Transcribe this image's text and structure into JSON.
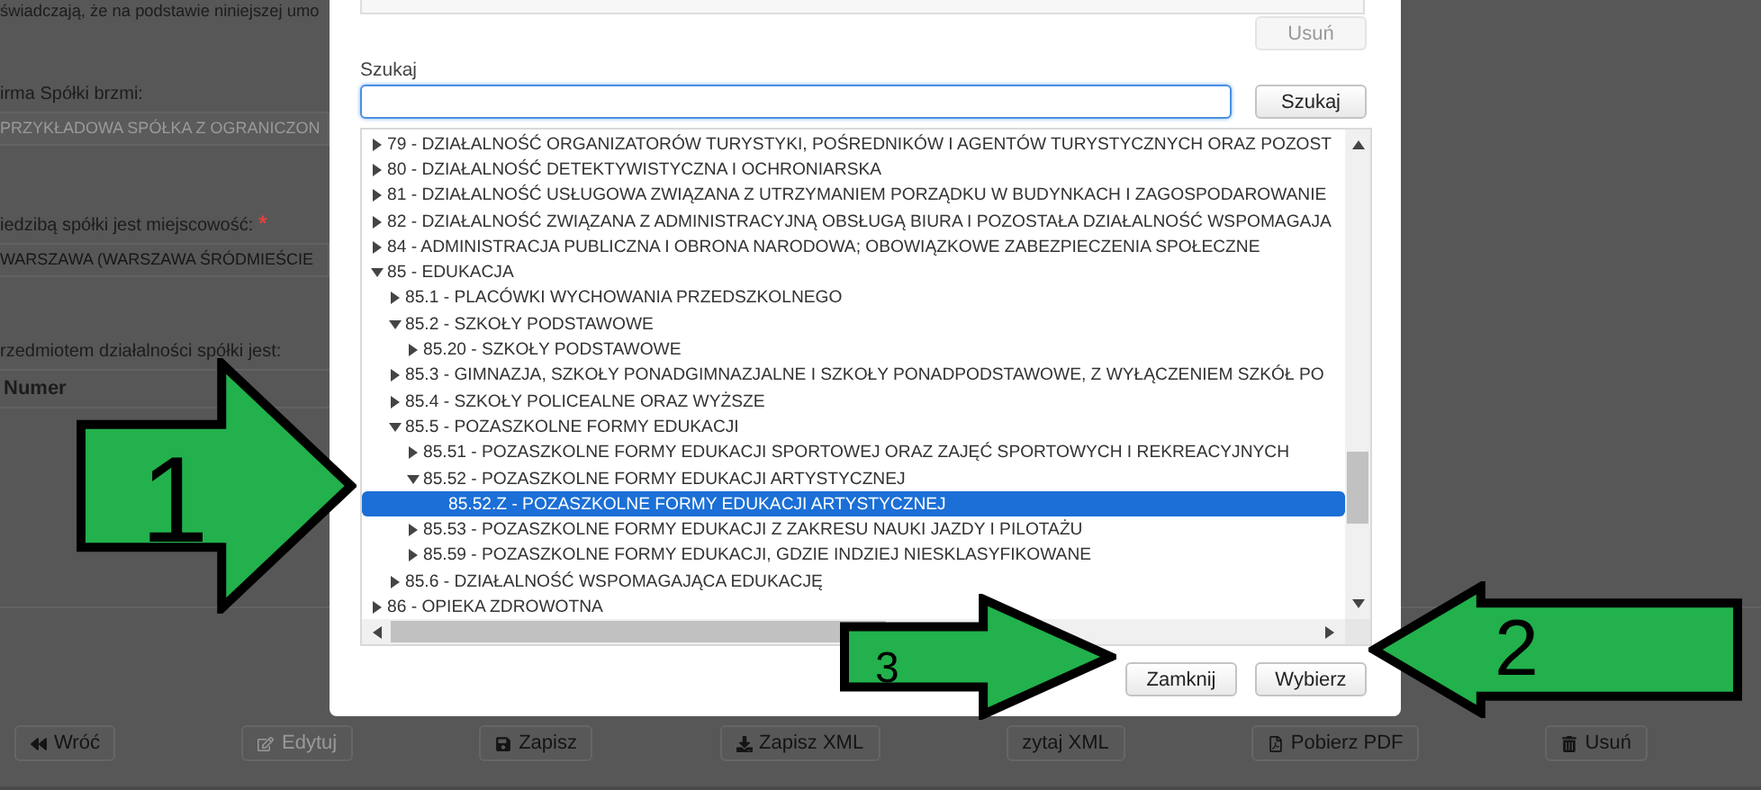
{
  "page": {
    "intro": "świadczają, że na podstawie niniejszej umo",
    "company_name_label": "irma Spółki brzmi:",
    "company_name_value": "PRZYKŁADOWA SPÓŁKA Z OGRANICZON",
    "seat_label": "iedzibą spółki jest miejscowość:",
    "seat_required_mark": "*",
    "seat_value": "WARSZAWA (WARSZAWA ŚRÓDMIEŚCIE",
    "activity_label": "rzedmiotem działalności spółki jest:",
    "table": {
      "columns": [
        "Numer"
      ]
    }
  },
  "toolbar": [
    {
      "label": "Wróć",
      "kind": "back",
      "disabled": false
    },
    {
      "label": "Edytuj",
      "kind": "edit",
      "disabled": true
    },
    {
      "label": "Zapisz",
      "kind": "save",
      "disabled": false
    },
    {
      "label": "Zapisz XML",
      "kind": "download",
      "disabled": false
    },
    {
      "label": "zytaj XML",
      "kind": "none",
      "disabled": false
    },
    {
      "label": "Pobierz PDF",
      "kind": "file",
      "disabled": false
    },
    {
      "label": "Usuń",
      "kind": "trash",
      "disabled": false
    }
  ],
  "dialog": {
    "delete_button": {
      "label": "Usuń",
      "disabled": true
    },
    "search": {
      "label": "Szukaj",
      "button": "Szukaj"
    },
    "tree": [
      {
        "label": "79 - DZIAŁALNOŚĆ ORGANIZATORÓW TURYSTYKI, POŚREDNIKÓW I AGENTÓW TURYSTYCZNYCH ORAZ POZOST",
        "expanded": false,
        "selected": false
      },
      {
        "label": "80 - DZIAŁALNOŚĆ DETEKTYWISTYCZNA I OCHRONIARSKA",
        "expanded": false,
        "selected": false
      },
      {
        "label": "81 - DZIAŁALNOŚĆ USŁUGOWA ZWIĄZANA Z UTRZYMANIEM PORZĄDKU W BUDYNKACH I ZAGOSPODAROWANIE",
        "expanded": false,
        "selected": false
      },
      {
        "label": "82 - DZIAŁALNOŚĆ ZWIĄZANA Z ADMINISTRACYJNĄ OBSŁUGĄ BIURA I POZOSTAŁA DZIAŁALNOŚĆ WSPOMAGAJA",
        "expanded": false,
        "selected": false
      },
      {
        "label": "84 - ADMINISTRACJA PUBLICZNA I OBRONA NARODOWA; OBOWIĄZKOWE ZABEZPIECZENIA SPOŁECZNE",
        "expanded": false,
        "selected": false
      },
      {
        "label": "85 - EDUKACJA",
        "expanded": true,
        "selected": false,
        "children": [
          {
            "label": "85.1 - PLACÓWKI WYCHOWANIA PRZEDSZKOLNEGO",
            "expanded": false,
            "selected": false
          },
          {
            "label": "85.2 - SZKOŁY PODSTAWOWE",
            "expanded": true,
            "selected": false,
            "children": [
              {
                "label": "85.20 - SZKOŁY PODSTAWOWE",
                "expanded": false,
                "selected": false
              }
            ]
          },
          {
            "label": "85.3 - GIMNAZJA, SZKOŁY PONADGIMNAZJALNE I SZKOŁY PONADPODSTAWOWE, Z WYŁĄCZENIEM SZKÓŁ PO",
            "expanded": false,
            "selected": false
          },
          {
            "label": "85.4 - SZKOŁY POLICEALNE ORAZ WYŻSZE",
            "expanded": false,
            "selected": false
          },
          {
            "label": "85.5 - POZASZKOLNE FORMY EDUKACJI",
            "expanded": true,
            "selected": false,
            "children": [
              {
                "label": "85.51 - POZASZKOLNE FORMY EDUKACJI SPORTOWEJ ORAZ ZAJĘĆ SPORTOWYCH I REKREACYJNYCH",
                "expanded": false,
                "selected": false
              },
              {
                "label": "85.52 - POZASZKOLNE FORMY EDUKACJI ARTYSTYCZNEJ",
                "expanded": true,
                "selected": false,
                "children": [
                  {
                    "label": "85.52.Z - POZASZKOLNE FORMY EDUKACJI ARTYSTYCZNEJ",
                    "selected": true
                  }
                ]
              },
              {
                "label": "85.53 - POZASZKOLNE FORMY EDUKACJI Z ZAKRESU NAUKI JAZDY I PILOTAŻU",
                "expanded": false,
                "selected": false
              },
              {
                "label": "85.59 - POZASZKOLNE FORMY EDUKACJI, GDZIE INDZIEJ NIESKLASYFIKOWANE",
                "expanded": false,
                "selected": false
              }
            ]
          },
          {
            "label": "85.6 - DZIAŁALNOŚĆ WSPOMAGAJĄCA EDUKACJĘ",
            "expanded": false,
            "selected": false
          }
        ]
      },
      {
        "label": "86 - OPIEKA ZDROWOTNA",
        "expanded": false,
        "selected": false
      }
    ],
    "buttons": [
      {
        "label": "Zamknij"
      },
      {
        "label": "Wybierz"
      }
    ]
  },
  "annotations": [
    {
      "label": "1"
    },
    {
      "label": "2"
    },
    {
      "label": "3"
    }
  ]
}
